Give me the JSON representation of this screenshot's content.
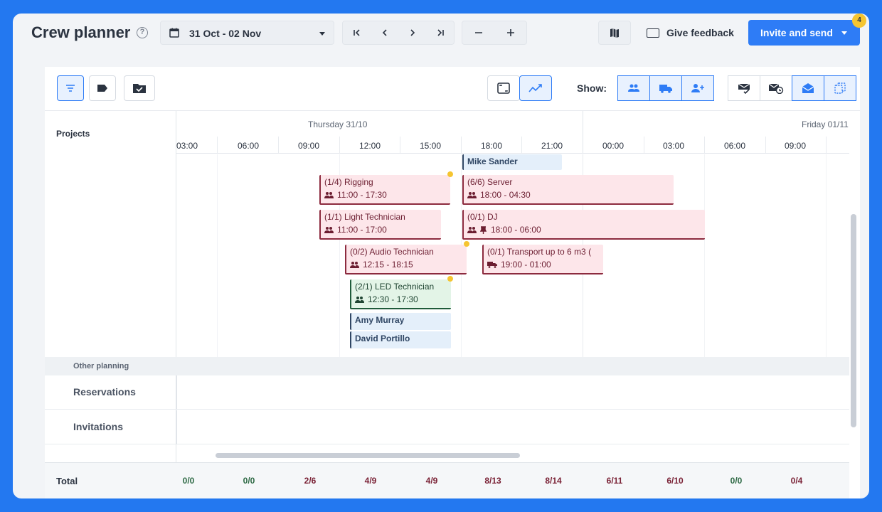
{
  "header": {
    "title": "Crew planner",
    "date_range": "31 Oct - 02 Nov",
    "feedback_label": "Give feedback",
    "invite_label": "Invite and send",
    "badge_count": "4"
  },
  "toolbar": {
    "show_label": "Show:"
  },
  "timeline": {
    "projects_label": "Projects",
    "days": [
      "Thursday 31/10",
      "Friday 01/11"
    ],
    "hours": [
      "03:00",
      "06:00",
      "09:00",
      "12:00",
      "15:00",
      "18:00",
      "21:00",
      "00:00",
      "03:00",
      "06:00",
      "09:00"
    ]
  },
  "bars": [
    {
      "title": "Mike Sander",
      "kind": "blue"
    },
    {
      "title": "(1/4) Rigging",
      "time": "11:00 - 17:30",
      "kind": "red",
      "icon": "people-icon"
    },
    {
      "title": "(6/6) Server",
      "time": "18:00 - 04:30",
      "kind": "red",
      "icon": "people-icon"
    },
    {
      "title": "(1/1) Light Technician",
      "time": "11:00 - 17:00",
      "kind": "red",
      "icon": "people-icon"
    },
    {
      "title": "(0/1) DJ",
      "time": "18:00 - 06:00",
      "kind": "red",
      "icon": "people-icon"
    },
    {
      "title": "(0/2) Audio Technician",
      "time": "12:15 - 18:15",
      "kind": "red",
      "icon": "people-icon"
    },
    {
      "title": "(0/1) Transport up to 6 m3 (",
      "time": "19:00 - 01:00",
      "kind": "red",
      "icon": "truck-icon"
    },
    {
      "title": "(2/1) LED Technician",
      "time": "12:30 - 17:30",
      "kind": "green",
      "icon": "people-icon"
    },
    {
      "title": "Amy Murray",
      "kind": "blue"
    },
    {
      "title": "David Portillo",
      "kind": "blue"
    }
  ],
  "sections": {
    "other_planning": "Other planning",
    "reservations": "Reservations",
    "invitations": "Invitations"
  },
  "totals": {
    "label": "Total",
    "values": [
      "0/0",
      "0/0",
      "2/6",
      "4/9",
      "4/9",
      "8/13",
      "8/14",
      "6/11",
      "6/10",
      "0/0",
      "0/4"
    ]
  },
  "colors": {
    "accent": "#2e7cf6",
    "shift_red": "#fde6ea",
    "shift_green": "#e3f4e7",
    "person_blue": "#e4effa",
    "badge": "#f5c531"
  }
}
